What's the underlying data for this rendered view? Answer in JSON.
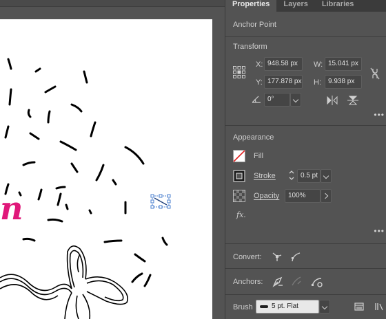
{
  "tabs": [
    "Properties",
    "Layers",
    "Libraries"
  ],
  "anchor_point_title": "Anchor Point",
  "transform": {
    "title": "Transform",
    "x_label": "X:",
    "x_value": "948.58 px",
    "y_label": "Y:",
    "y_value": "177.878 px",
    "w_label": "W:",
    "w_value": "15.041 px",
    "h_label": "H:",
    "h_value": "9.938 px",
    "angle_value": "0°"
  },
  "appearance": {
    "title": "Appearance",
    "fill_label": "Fill",
    "stroke_label": "Stroke",
    "stroke_value": "0.5 pt",
    "opacity_label": "Opacity",
    "opacity_value": "100%",
    "fx_label": "fx."
  },
  "convert_label": "Convert:",
  "anchors_label": "Anchors:",
  "brush_label": "Brush",
  "brush_value": "5 pt. Flat",
  "art_letter": "n",
  "colors": {
    "panel": "#535353",
    "tabbar": "#3b3b3b",
    "accent_pink": "#e0187a",
    "selection_blue": "#4a7fcf"
  }
}
